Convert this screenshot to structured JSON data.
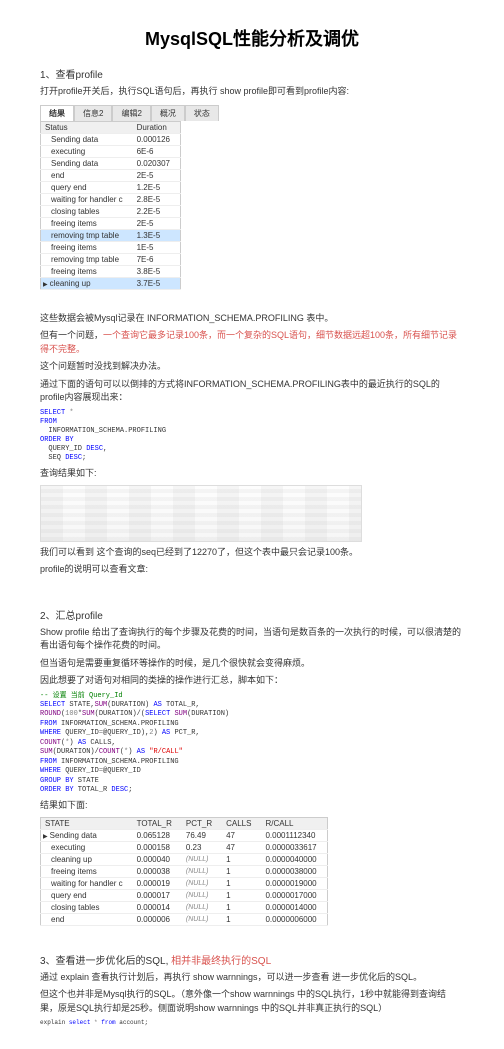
{
  "title": "MysqlSQL性能分析及调优",
  "s1": {
    "heading": "1、查看profile",
    "intro": "打开profile开关后，执行SQL语句后，再执行 show profile即可看到profile内容:",
    "tabs": [
      "结果",
      "信息2",
      "编辑2",
      "概况",
      "状态"
    ],
    "cols": [
      "Status",
      "Duration"
    ],
    "rows": [
      [
        "Sending data",
        "0.000126"
      ],
      [
        "executing",
        "6E-6"
      ],
      [
        "Sending data",
        "0.020307"
      ],
      [
        "end",
        "2E-5"
      ],
      [
        "query end",
        "1.2E-5"
      ],
      [
        "waiting for handler c",
        "2.8E-5"
      ],
      [
        "closing tables",
        "2.2E-5"
      ],
      [
        "freeing items",
        "2E-5"
      ],
      [
        "removing tmp table",
        "1.3E-5"
      ],
      [
        "freeing items",
        "1E-5"
      ],
      [
        "removing tmp table",
        "7E-6"
      ],
      [
        "freeing items",
        "3.8E-5"
      ],
      [
        "cleaning up",
        "3.7E-5"
      ]
    ],
    "p1": "这些数据会被Mysql记录在 INFORMATION_SCHEMA.PROFILING 表中。",
    "p2a": "但有一个问题，",
    "p2b": "一个查询它最多记录100条，而一个复杂的SQL语句，细节数据远超100条，所有细节记录得不完整。",
    "p3": "这个问题暂时没找到解决办法。",
    "p4": "通过下面的语句可以以倒排的方式将INFORMATION_SCHEMA.PROFILING表中的最近执行的SQL的profile内容展现出来：",
    "sql": "SELECT *\nFROM\n  INFORMATION_SCHEMA.PROFILING\nORDER BY\n  QUERY_ID DESC,\n  SEQ DESC;",
    "p5": "查询结果如下:",
    "p6": "我们可以看到 这个查询的seq已经到了12270了，但这个表中最只会记录100条。",
    "p7": "profile的说明可以查看文章:"
  },
  "s2": {
    "heading": "2、汇总profile",
    "p1": "Show profile 给出了查询执行的每个步骤及花费的时间，当语句是数百条的一次执行的时候，可以很清楚的看出语句每个操作花费的时间。",
    "p2": "但当语句是需要重复循环等操作的时候，是几个很快就会变得麻烦。",
    "p3": "因此想要了对语句对相同的类操的操作进行汇总，脚本如下：",
    "sql_lines": [
      {
        "t": "-- 设置 当前 Query_Id",
        "cls": "g"
      },
      {
        "t": "SELECT STATE,SUM(DURATION) AS TOTAL_R,",
        "cls": ""
      },
      {
        "t": "ROUND(100*SUM(DURATION)/(SELECT SUM(DURATION)",
        "cls": ""
      },
      {
        "t": "FROM INFORMATION_SCHEMA.PROFILING",
        "cls": ""
      },
      {
        "t": "WHERE QUERY_ID=@QUERY_ID),2) AS PCT_R,",
        "cls": ""
      },
      {
        "t": "COUNT(*) AS CALLS,",
        "cls": ""
      },
      {
        "t": "SUM(DURATION)/COUNT(*) AS \"R/CALL\"",
        "cls": ""
      },
      {
        "t": "FROM INFORMATION_SCHEMA.PROFILING",
        "cls": ""
      },
      {
        "t": "WHERE QUERY_ID=@QUERY_ID",
        "cls": ""
      },
      {
        "t": "GROUP BY STATE",
        "cls": ""
      },
      {
        "t": "ORDER BY TOTAL_R DESC;",
        "cls": ""
      }
    ],
    "p4": "结果如下面:",
    "cols2": [
      "STATE",
      "TOTAL_R",
      "PCT_R",
      "CALLS",
      "R/CALL"
    ],
    "rows2": [
      [
        "Sending data",
        "0.065128",
        "76.49",
        "47",
        "0.0001112340"
      ],
      [
        "executing",
        "0.000158",
        "0.23",
        "47",
        "0.0000033617"
      ],
      [
        "cleaning up",
        "0.000040",
        "(NULL)",
        "1",
        "0.0000040000"
      ],
      [
        "freeing items",
        "0.000038",
        "(NULL)",
        "1",
        "0.0000038000"
      ],
      [
        "waiting for handler c",
        "0.000019",
        "(NULL)",
        "1",
        "0.0000019000"
      ],
      [
        "query end",
        "0.000017",
        "(NULL)",
        "1",
        "0.0000017000"
      ],
      [
        "closing tables",
        "0.000014",
        "(NULL)",
        "1",
        "0.0000014000"
      ],
      [
        "end",
        "0.000006",
        "(NULL)",
        "1",
        "0.0000006000"
      ]
    ]
  },
  "s3": {
    "heading_a": "3、查看进一步优化后的SQL,",
    "heading_b": " 相并非最终执行的SQL",
    "p1": "通过 explain 查看执行计划后，再执行 show warnnings，可以进一步查看 进一步优化后的SQL。",
    "p2": "但这个也并非是Mysql执行的SQL。（意外像一个show warnnings 中的SQL执行，1秒中就能得到查询结果，原是SQL执行却是25秒。侧面说明show warnnings 中的SQL并非真正执行的SQL）",
    "code": "explain select * from account;"
  }
}
